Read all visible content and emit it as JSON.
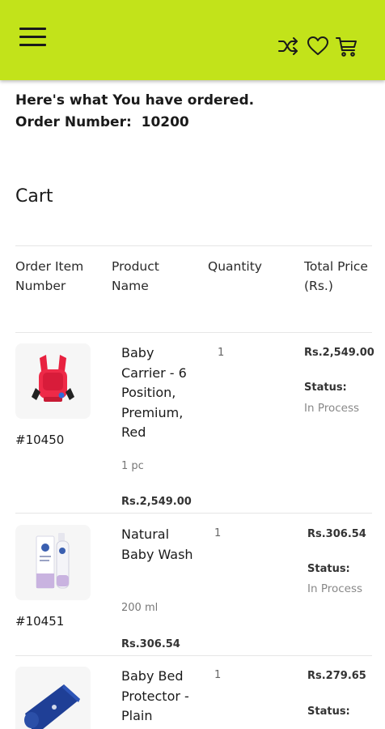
{
  "header": {
    "menu_icon": "hamburger-menu-icon",
    "icons": [
      "shuffle-icon",
      "heart-icon",
      "cart-icon"
    ],
    "accent_color": "#c2e31a"
  },
  "order": {
    "heading": "Here's what You have ordered.",
    "number_label": "Order Number:",
    "number": "10200"
  },
  "cart": {
    "title": "Cart",
    "columns": {
      "order_item_number": "Order Item Number",
      "product_name": "Product Name",
      "quantity": "Quantity",
      "total_price": "Total Price (Rs.)"
    },
    "items": [
      {
        "order_item_number": "#10450",
        "name": "Baby Carrier - 6 Position, Premium, Red",
        "pack_size": "1 pc",
        "unit_price": "Rs.2,549.00",
        "quantity": "1",
        "total": "Rs.2,549.00",
        "status_label": "Status:",
        "status": "In Process"
      },
      {
        "order_item_number": "#10451",
        "name": "Natural Baby Wash",
        "pack_size": "200 ml",
        "unit_price": "Rs.306.54",
        "quantity": "1",
        "total": "Rs.306.54",
        "status_label": "Status:",
        "status": "In Process"
      },
      {
        "name": "Baby Bed Protector - Plain",
        "quantity": "1",
        "total": "Rs.279.65",
        "status_label": "Status:"
      }
    ]
  }
}
